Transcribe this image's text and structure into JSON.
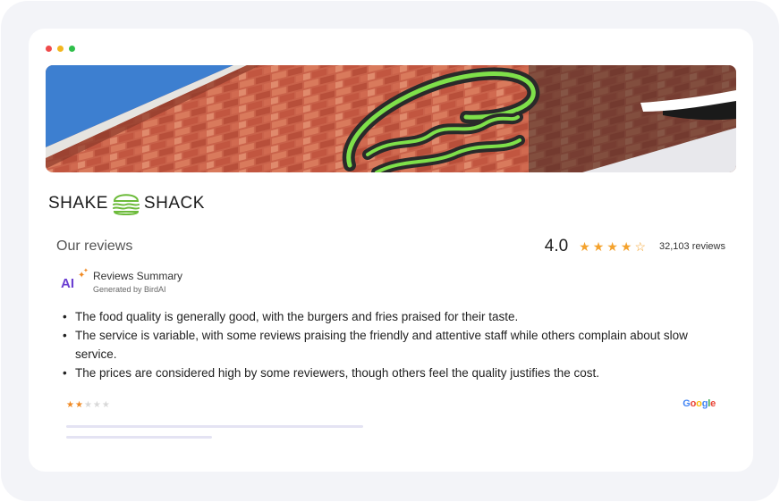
{
  "window": {
    "controls": [
      "close",
      "minimize",
      "maximize"
    ]
  },
  "banner": {
    "image": "shake-shack-neon-burger-sign-on-brick-wall"
  },
  "brand": {
    "left": "SHAKE",
    "right": "SHACK",
    "icon": "burger-icon"
  },
  "reviews": {
    "title": "Our reviews",
    "rating": "4.0",
    "stars_filled": 4,
    "stars_total": 5,
    "count_text": "32,103 reviews"
  },
  "summary": {
    "badge": "AI",
    "title": "Reviews Summary",
    "subtitle": "Generated by BirdAI",
    "bullets": [
      "The food quality is generally good, with the burgers and fries praised for their taste.",
      "The service is variable, with some reviews praising the friendly and attentive staff while others complain about slow service.",
      "The prices are considered high by some reviewers, though others feel the quality justifies the cost."
    ]
  },
  "review_card": {
    "stars_filled": 2,
    "stars_total": 5,
    "source": "Google"
  },
  "colors": {
    "accent_star": "#f4a22d",
    "ai_purple": "#6b3fd1",
    "burger_green": "#6dbb3b"
  }
}
